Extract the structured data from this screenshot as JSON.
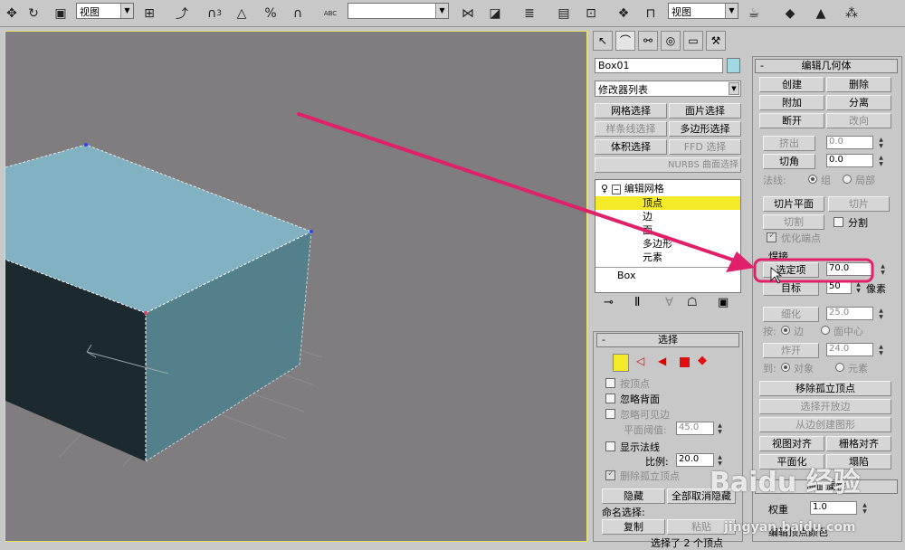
{
  "toolbar": {
    "view_combo": "视图",
    "snap_3": "3",
    "abc": "ABC",
    "view_combo2": "视图",
    "empty_combo": ""
  },
  "viewport": {
    "note": ""
  },
  "cmdpanel": {
    "object_name": "Box01",
    "modifier_list": "修改器列表",
    "mod_buttons": [
      "网格选择",
      "面片选择",
      "样条线选择",
      "多边形选择",
      "体积选择",
      "FFD 选择",
      "NURBS 曲面选择"
    ],
    "stack": {
      "root": "编辑网格",
      "items": [
        "顶点",
        "边",
        "面",
        "多边形",
        "元素"
      ],
      "base": "Box"
    },
    "select_rollout": {
      "title": "选择",
      "by_vertex": "按顶点",
      "ignore_backface": "忽略背面",
      "ignore_visible_edges": "忽略可见边",
      "planar_threshold_label": "平面阈值:",
      "planar_threshold": "45.0",
      "show_normals": "显示法线",
      "scale_label": "比例:",
      "scale": "20.0",
      "delete_isolated": "删除孤立顶点",
      "hide": "隐藏",
      "unhide_all": "全部取消隐藏",
      "named_sel": "命名选择:",
      "copy": "复制",
      "paste": "粘贴",
      "selected": "选择了 2 个顶点"
    },
    "edit_geom": {
      "title": "编辑几何体",
      "create": "创建",
      "delete": "删除",
      "attach": "附加",
      "detach": "分离",
      "break": "断开",
      "turn": "改向",
      "extrude": "挤出",
      "extrude_val": "0.0",
      "chamfer": "切角",
      "chamfer_val": "0.0",
      "normal_label": "法线:",
      "group": "组",
      "local": "局部",
      "slice_plane": "切片平面",
      "slice": "切片",
      "cut": "切割",
      "split": "分割",
      "refine_ends": "优化端点",
      "weld_label": "焊接",
      "selected_btn": "选定项",
      "selected_val": "70.0",
      "target_btn": "目标",
      "target_val": "50",
      "pixels": "像素",
      "tessellate": "细化",
      "tess_val": "25.0",
      "by_label": "按:",
      "edge": "边",
      "face_center": "面中心",
      "explode": "炸开",
      "explode_val": "24.0",
      "to_label": "到:",
      "object": "对象",
      "element": "元素",
      "remove_isolated": "移除孤立顶点",
      "select_open_edges": "选择开放边",
      "create_shape": "从边创建图形",
      "view_align": "视图对齐",
      "grid_align": "栅格对齐",
      "planarize": "平面化",
      "collapse": "塌陷",
      "surface_props": "曲面属性",
      "weight_label": "权重",
      "weight_val": "1.0",
      "vertex_color": "编辑顶点颜色"
    }
  },
  "watermark": {
    "brand": "Baidu 经验",
    "url": "jingyan.baidu.com"
  },
  "colors": {
    "viewport_bg": "#7f7d80",
    "box_top": "#82b2c2",
    "box_right": "#54808c",
    "box_front": "#1c2a30",
    "arrow": "#e0206a",
    "highlight": "#f4ea28"
  }
}
